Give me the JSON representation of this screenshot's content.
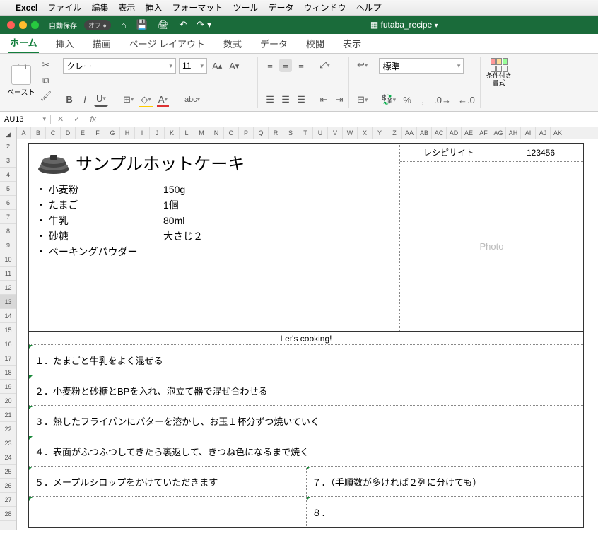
{
  "menubar": {
    "app": "Excel",
    "items": [
      "ファイル",
      "編集",
      "表示",
      "挿入",
      "フォーマット",
      "ツール",
      "データ",
      "ウィンドウ",
      "ヘルプ"
    ]
  },
  "titlebar": {
    "autosave": "自動保存",
    "autosave_state": "オフ",
    "docname": "futaba_recipe"
  },
  "tabs": [
    "ホーム",
    "挿入",
    "描画",
    "ページ レイアウト",
    "数式",
    "データ",
    "校閲",
    "表示"
  ],
  "active_tab": 0,
  "ribbon": {
    "paste": "ペースト",
    "font": "クレー",
    "size": "11",
    "numfmt": "標準",
    "condfmt": "条件付き書式"
  },
  "namebox": "AU13",
  "fx": "fx",
  "cols": [
    "A",
    "B",
    "C",
    "D",
    "E",
    "F",
    "G",
    "H",
    "I",
    "J",
    "K",
    "L",
    "M",
    "N",
    "O",
    "P",
    "Q",
    "R",
    "S",
    "T",
    "U",
    "V",
    "W",
    "X",
    "Y",
    "Z",
    "AA",
    "AB",
    "AC",
    "AD",
    "AE",
    "AF",
    "AG",
    "AH",
    "AI",
    "AJ",
    "AK"
  ],
  "recipe": {
    "title": "サンプルホットケーキ",
    "meta_label": "レシピサイト",
    "meta_value": "123456",
    "photo": "Photo",
    "ingredients": [
      {
        "name": "・ 小麦粉",
        "amount": "150g"
      },
      {
        "name": "・ たまご",
        "amount": "1個"
      },
      {
        "name": "・ 牛乳",
        "amount": "80ml"
      },
      {
        "name": "・ 砂糖",
        "amount": "大さじ２"
      },
      {
        "name": "・ ベーキングパウダー",
        "amount": ""
      }
    ],
    "cook_header": "Let's cooking!",
    "steps": [
      "１．たまごと牛乳をよく混ぜる",
      "２．小麦粉と砂糖とBPを入れ、泡立て器で混ぜ合わせる",
      "３．熱したフライパンにバターを溶かし、お玉１杯分ずつ焼いていく",
      "４．表面がふつふつしてきたら裏返して、きつね色になるまで焼く",
      "５．メープルシロップをかけていただきます",
      "",
      "７．（手順数が多ければ２列に分けても）",
      "８．"
    ]
  }
}
